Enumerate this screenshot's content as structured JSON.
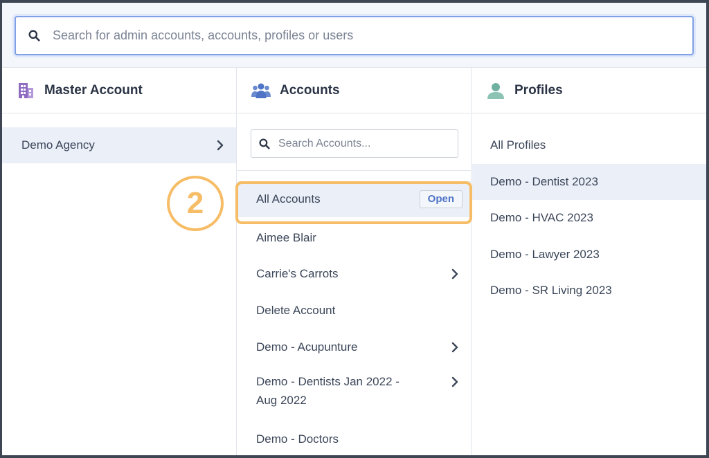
{
  "search": {
    "placeholder": "Search for admin accounts, accounts, profiles or users"
  },
  "columns": {
    "master": {
      "title": "Master Account",
      "icon": "building-icon",
      "items": [
        {
          "label": "Demo Agency",
          "selected": true,
          "has_children": true
        }
      ]
    },
    "accounts": {
      "title": "Accounts",
      "icon": "users-group-icon",
      "search_placeholder": "Search Accounts...",
      "items": [
        {
          "label": "All Accounts",
          "selected": true,
          "action": "Open"
        },
        {
          "label": "Aimee Blair"
        },
        {
          "label": "Carrie's Carrots",
          "has_children": true
        },
        {
          "label": "Delete Account"
        },
        {
          "label": "Demo - Acupunture",
          "has_children": true
        },
        {
          "label": "Demo - Dentists Jan 2022 - Aug 2022",
          "has_children": true
        },
        {
          "label": "Demo - Doctors"
        }
      ]
    },
    "profiles": {
      "title": "Profiles",
      "icon": "user-icon",
      "items": [
        {
          "label": "All Profiles"
        },
        {
          "label": "Demo - Dentist 2023",
          "selected": true
        },
        {
          "label": "Demo - HVAC 2023"
        },
        {
          "label": "Demo - Lawyer 2023"
        },
        {
          "label": "Demo - SR Living 2023"
        }
      ]
    }
  },
  "annotation": {
    "step": "2"
  },
  "colors": {
    "accent": "#7f9fe6",
    "highlight": "#f6bd66",
    "selected_bg": "#ebeff8",
    "link": "#4f74c6"
  }
}
